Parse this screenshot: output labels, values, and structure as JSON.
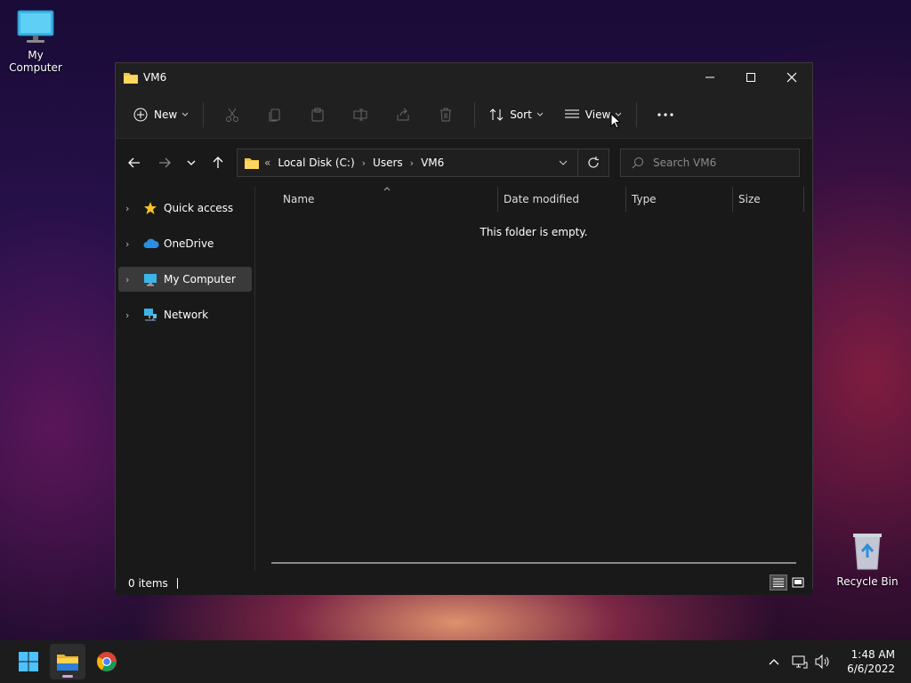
{
  "desktop": {
    "my_computer_label": "My Computer",
    "recycle_bin_label": "Recycle Bin"
  },
  "window": {
    "title": "VM6",
    "toolbar": {
      "new_label": "New",
      "sort_label": "Sort",
      "view_label": "View"
    },
    "address": {
      "overflow": "«",
      "crumbs": [
        "Local Disk (C:)",
        "Users",
        "VM6"
      ]
    },
    "search": {
      "placeholder": "Search VM6"
    },
    "nav": {
      "items": [
        {
          "label": "Quick access",
          "icon": "star-icon"
        },
        {
          "label": "OneDrive",
          "icon": "cloud-icon"
        },
        {
          "label": "My Computer",
          "icon": "computer-icon",
          "selected": true
        },
        {
          "label": "Network",
          "icon": "network-icon"
        }
      ]
    },
    "columns": [
      "Name",
      "Date modified",
      "Type",
      "Size"
    ],
    "empty_message": "This folder is empty.",
    "status": {
      "items_text": "0 items"
    }
  },
  "taskbar": {
    "clock_time": "1:48 AM",
    "clock_date": "6/6/2022"
  },
  "colors": {
    "accent": "#0078d4",
    "folder": "#f4c542",
    "window_bg": "#191919"
  }
}
